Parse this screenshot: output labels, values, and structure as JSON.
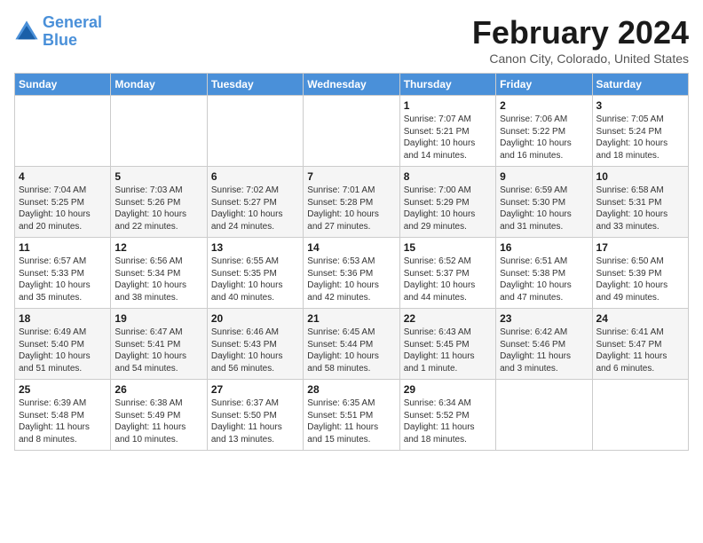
{
  "header": {
    "logo_line1": "General",
    "logo_line2": "Blue",
    "month": "February 2024",
    "location": "Canon City, Colorado, United States"
  },
  "days_of_week": [
    "Sunday",
    "Monday",
    "Tuesday",
    "Wednesday",
    "Thursday",
    "Friday",
    "Saturday"
  ],
  "weeks": [
    [
      {
        "day": "",
        "info": ""
      },
      {
        "day": "",
        "info": ""
      },
      {
        "day": "",
        "info": ""
      },
      {
        "day": "",
        "info": ""
      },
      {
        "day": "1",
        "info": "Sunrise: 7:07 AM\nSunset: 5:21 PM\nDaylight: 10 hours\nand 14 minutes."
      },
      {
        "day": "2",
        "info": "Sunrise: 7:06 AM\nSunset: 5:22 PM\nDaylight: 10 hours\nand 16 minutes."
      },
      {
        "day": "3",
        "info": "Sunrise: 7:05 AM\nSunset: 5:24 PM\nDaylight: 10 hours\nand 18 minutes."
      }
    ],
    [
      {
        "day": "4",
        "info": "Sunrise: 7:04 AM\nSunset: 5:25 PM\nDaylight: 10 hours\nand 20 minutes."
      },
      {
        "day": "5",
        "info": "Sunrise: 7:03 AM\nSunset: 5:26 PM\nDaylight: 10 hours\nand 22 minutes."
      },
      {
        "day": "6",
        "info": "Sunrise: 7:02 AM\nSunset: 5:27 PM\nDaylight: 10 hours\nand 24 minutes."
      },
      {
        "day": "7",
        "info": "Sunrise: 7:01 AM\nSunset: 5:28 PM\nDaylight: 10 hours\nand 27 minutes."
      },
      {
        "day": "8",
        "info": "Sunrise: 7:00 AM\nSunset: 5:29 PM\nDaylight: 10 hours\nand 29 minutes."
      },
      {
        "day": "9",
        "info": "Sunrise: 6:59 AM\nSunset: 5:30 PM\nDaylight: 10 hours\nand 31 minutes."
      },
      {
        "day": "10",
        "info": "Sunrise: 6:58 AM\nSunset: 5:31 PM\nDaylight: 10 hours\nand 33 minutes."
      }
    ],
    [
      {
        "day": "11",
        "info": "Sunrise: 6:57 AM\nSunset: 5:33 PM\nDaylight: 10 hours\nand 35 minutes."
      },
      {
        "day": "12",
        "info": "Sunrise: 6:56 AM\nSunset: 5:34 PM\nDaylight: 10 hours\nand 38 minutes."
      },
      {
        "day": "13",
        "info": "Sunrise: 6:55 AM\nSunset: 5:35 PM\nDaylight: 10 hours\nand 40 minutes."
      },
      {
        "day": "14",
        "info": "Sunrise: 6:53 AM\nSunset: 5:36 PM\nDaylight: 10 hours\nand 42 minutes."
      },
      {
        "day": "15",
        "info": "Sunrise: 6:52 AM\nSunset: 5:37 PM\nDaylight: 10 hours\nand 44 minutes."
      },
      {
        "day": "16",
        "info": "Sunrise: 6:51 AM\nSunset: 5:38 PM\nDaylight: 10 hours\nand 47 minutes."
      },
      {
        "day": "17",
        "info": "Sunrise: 6:50 AM\nSunset: 5:39 PM\nDaylight: 10 hours\nand 49 minutes."
      }
    ],
    [
      {
        "day": "18",
        "info": "Sunrise: 6:49 AM\nSunset: 5:40 PM\nDaylight: 10 hours\nand 51 minutes."
      },
      {
        "day": "19",
        "info": "Sunrise: 6:47 AM\nSunset: 5:41 PM\nDaylight: 10 hours\nand 54 minutes."
      },
      {
        "day": "20",
        "info": "Sunrise: 6:46 AM\nSunset: 5:43 PM\nDaylight: 10 hours\nand 56 minutes."
      },
      {
        "day": "21",
        "info": "Sunrise: 6:45 AM\nSunset: 5:44 PM\nDaylight: 10 hours\nand 58 minutes."
      },
      {
        "day": "22",
        "info": "Sunrise: 6:43 AM\nSunset: 5:45 PM\nDaylight: 11 hours\nand 1 minute."
      },
      {
        "day": "23",
        "info": "Sunrise: 6:42 AM\nSunset: 5:46 PM\nDaylight: 11 hours\nand 3 minutes."
      },
      {
        "day": "24",
        "info": "Sunrise: 6:41 AM\nSunset: 5:47 PM\nDaylight: 11 hours\nand 6 minutes."
      }
    ],
    [
      {
        "day": "25",
        "info": "Sunrise: 6:39 AM\nSunset: 5:48 PM\nDaylight: 11 hours\nand 8 minutes."
      },
      {
        "day": "26",
        "info": "Sunrise: 6:38 AM\nSunset: 5:49 PM\nDaylight: 11 hours\nand 10 minutes."
      },
      {
        "day": "27",
        "info": "Sunrise: 6:37 AM\nSunset: 5:50 PM\nDaylight: 11 hours\nand 13 minutes."
      },
      {
        "day": "28",
        "info": "Sunrise: 6:35 AM\nSunset: 5:51 PM\nDaylight: 11 hours\nand 15 minutes."
      },
      {
        "day": "29",
        "info": "Sunrise: 6:34 AM\nSunset: 5:52 PM\nDaylight: 11 hours\nand 18 minutes."
      },
      {
        "day": "",
        "info": ""
      },
      {
        "day": "",
        "info": ""
      }
    ]
  ]
}
